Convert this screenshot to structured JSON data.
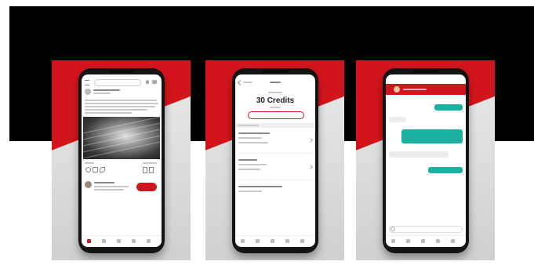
{
  "colors": {
    "brand_red": "#d2151c",
    "teal": "#1cb0a0",
    "top_band": "#000000"
  },
  "phone2": {
    "credits_value": "30 Credits"
  }
}
